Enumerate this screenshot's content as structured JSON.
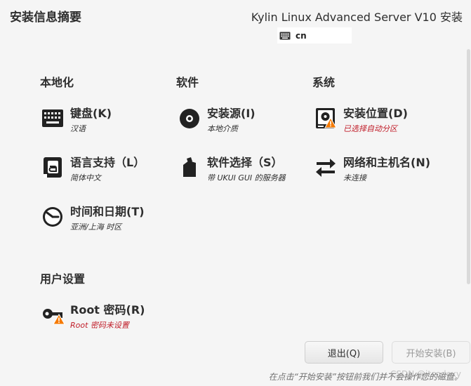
{
  "header": {
    "title": "安装信息摘要",
    "product": "Kylin Linux Advanced Server V10 安装",
    "keyboard_layout": "cn"
  },
  "sections": {
    "localization": "本地化",
    "software": "软件",
    "system": "系统",
    "user_settings": "用户设置"
  },
  "spokes": {
    "keyboard": {
      "name": "键盘(K)",
      "status": "汉语",
      "icon": "keyboard-icon"
    },
    "language": {
      "name": "语言支持（L）",
      "status": "简体中文",
      "icon": "language-icon"
    },
    "time": {
      "name": "时间和日期(T)",
      "status": "亚洲/上海 时区",
      "icon": "clock-icon"
    },
    "source": {
      "name": "安装源(I)",
      "status": "本地介质",
      "icon": "disc-icon"
    },
    "software_selection": {
      "name": "软件选择（S）",
      "status": "带 UKUI GUI 的服务器",
      "icon": "package-icon"
    },
    "install_dest": {
      "name": "安装位置(D)",
      "status": "已选择自动分区",
      "icon": "harddisk-icon",
      "warning": true
    },
    "network": {
      "name": "网络和主机名(N)",
      "status": "未连接",
      "icon": "network-arrows-icon"
    },
    "root": {
      "name": "Root 密码(R)",
      "status": "Root 密码未设置",
      "icon": "key-icon",
      "warning": true
    }
  },
  "buttons": {
    "quit": "退出(Q)",
    "begin": "开始安装(B)"
  },
  "footer_note": "在点击“开始安装”按钮前我们并不会操作您的磁盘。",
  "watermark": "CSDN @itcodexy",
  "colors": {
    "warning": "#c01c28",
    "warning_icon": "#f57900",
    "text": "#2e2e2e",
    "background": "#f5f5f5"
  }
}
